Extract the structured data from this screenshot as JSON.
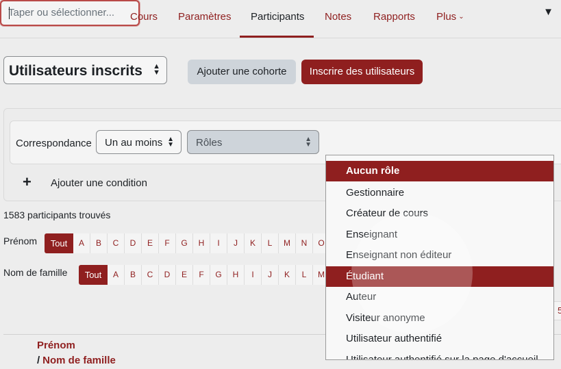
{
  "nav": {
    "tabs": [
      {
        "label": "Cours"
      },
      {
        "label": "Paramètres"
      },
      {
        "label": "Participants"
      },
      {
        "label": "Notes"
      },
      {
        "label": "Rapports"
      },
      {
        "label": "Plus"
      }
    ],
    "active_tab": "Participants"
  },
  "header": {
    "enrol_select": "Utilisateurs inscrits",
    "add_cohort_button": "Ajouter une cohorte",
    "enrol_users_button": "Inscrire des utilisateurs"
  },
  "filter": {
    "match_label": "Correspondance",
    "match_value": "Un au moins",
    "type_value": "Rôles",
    "roles_placeholder": "Taper ou sélectionner...",
    "add_condition": "Ajouter une condition"
  },
  "results": {
    "count_text": "1583 participants trouvés"
  },
  "initials": {
    "firstname_label": "Prénom",
    "lastname_label": "Nom de famille",
    "all": "Tout",
    "firstname_letters": [
      "A",
      "B",
      "C",
      "D",
      "E",
      "F",
      "G",
      "H",
      "I",
      "J",
      "K",
      "L",
      "M",
      "N",
      "O"
    ],
    "lastname_letters": [
      "A",
      "B",
      "C",
      "D",
      "E",
      "F",
      "G",
      "H",
      "I",
      "J",
      "K",
      "L",
      "M"
    ]
  },
  "pagination_partial": "5",
  "table_header": {
    "firstname": "Prénom",
    "slash": "/",
    "lastname": "Nom de famille"
  },
  "roles_dropdown": {
    "options": [
      "Aucun rôle",
      "Gestionnaire",
      "Créateur de cours",
      "Enseignant",
      "Enseignant non éditeur",
      "Étudiant",
      "Auteur",
      "Visiteur anonyme",
      "Utilisateur authentifié",
      "Utilisateur authentifié sur la page d'accueil"
    ],
    "selected": "Aucun rôle",
    "highlighted": "Étudiant"
  },
  "colors": {
    "brand": "#8f1f1f",
    "background": "#ededed"
  }
}
